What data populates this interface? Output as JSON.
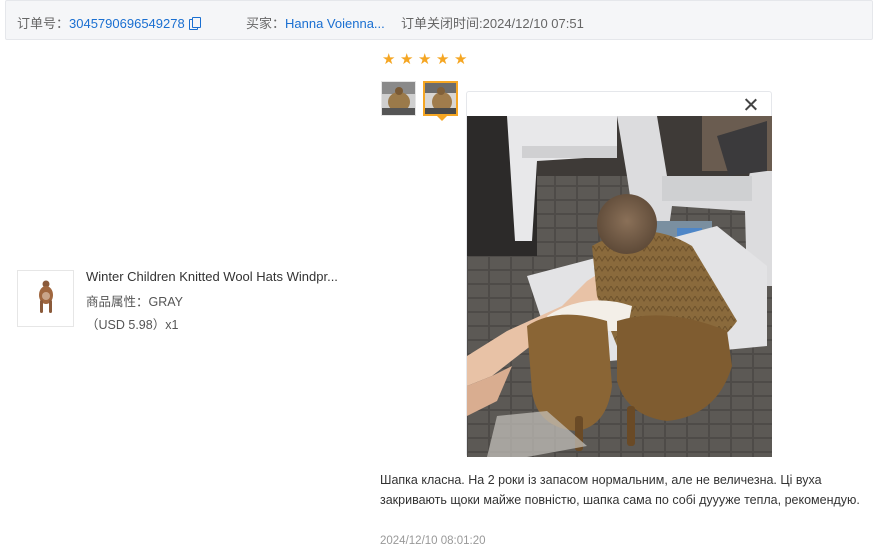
{
  "order": {
    "number_label": "订单号：",
    "number": "3045790696549278",
    "buyer_label": "买家：",
    "buyer": "Hanna Voienna...",
    "closed_label": "订单关闭时间:",
    "closed_time": "2024/12/10 07:51"
  },
  "product": {
    "title": "Winter Children Knitted Wool Hats Windpr...",
    "attr_label": "商品属性：",
    "attr_value": "GRAY",
    "price": "（USD  5.98）x1"
  },
  "review": {
    "rating": 5,
    "star_color": "#f5a623",
    "text": "Шапка класна. На 2 роки із запасом нормальним, але не величезна. Ці вуха закривають щоки майже повністю, шапка сама по собі дуууже тепла, рекомендую.",
    "date": "2024/12/10 08:01:20",
    "photos_count": 2,
    "active_photo_index": 1
  },
  "icons": {
    "copy": "copy-icon",
    "close": "close-icon",
    "star": "star-icon"
  },
  "colors": {
    "link": "#1a6fd1",
    "accent": "#f5a623",
    "header_bg": "#f5f6f8"
  }
}
